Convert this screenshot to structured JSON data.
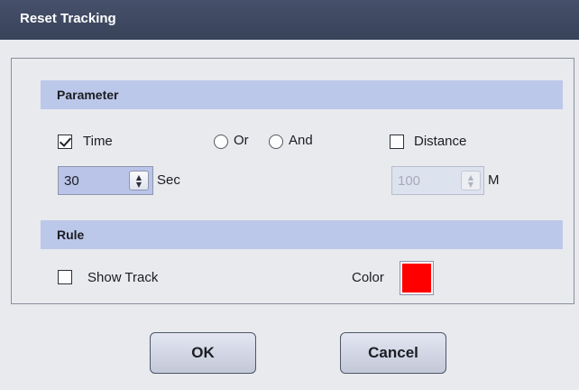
{
  "window": {
    "title": "Reset Tracking"
  },
  "parameter": {
    "title": "Parameter",
    "time": {
      "label": "Time",
      "checked": true
    },
    "or_label": "Or",
    "and_label": "And",
    "distance": {
      "label": "Distance",
      "checked": false
    },
    "time_value": "30",
    "time_unit": "Sec",
    "distance_value": "100",
    "distance_unit": "M"
  },
  "rule": {
    "title": "Rule",
    "show_track_label": "Show Track",
    "show_track_checked": false,
    "color_label": "Color",
    "color_value": "#ff0000"
  },
  "buttons": {
    "ok": "OK",
    "cancel": "Cancel"
  },
  "icons": {
    "spin_up": "▲",
    "spin_down": "▼"
  }
}
